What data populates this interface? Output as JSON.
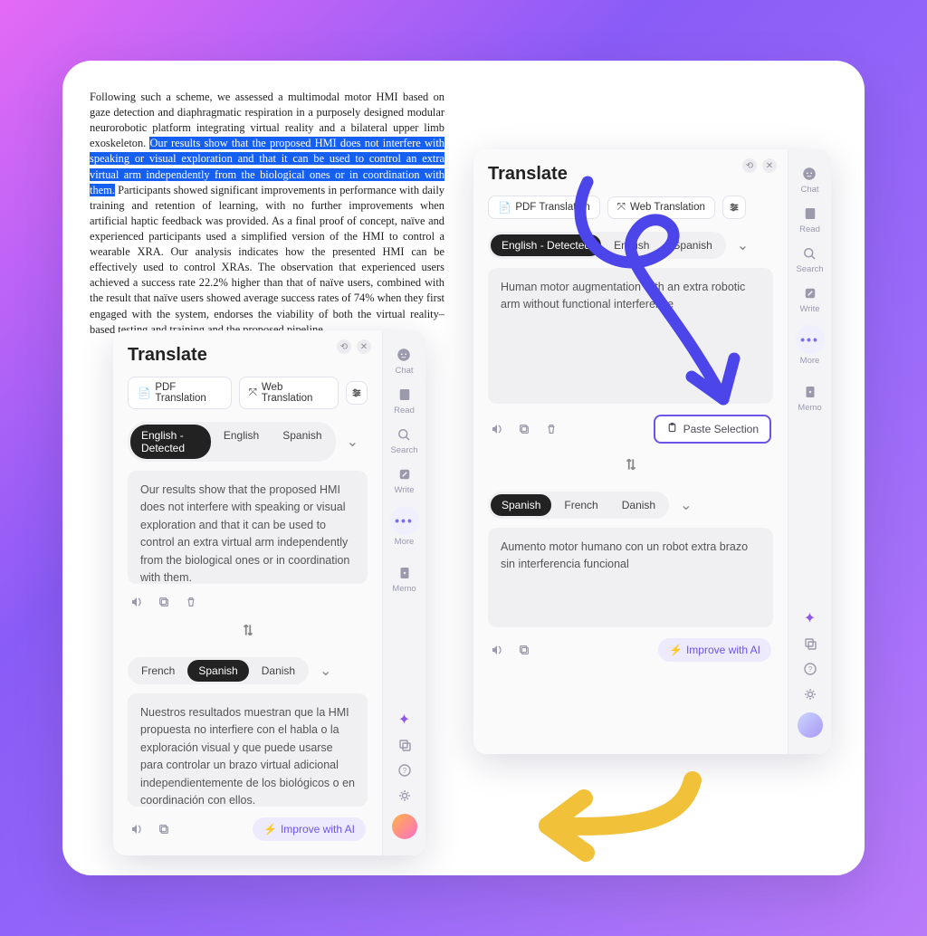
{
  "paragraph": {
    "pre": "Following such a scheme, we assessed a multimodal motor HMI based on gaze detection and diaphragmatic respiration in a purposely designed modular neurorobotic platform integrating virtual reality and a bilateral upper limb exoskeleton. ",
    "highlight": "Our results show that the proposed HMI does not interfere with speaking or visual exploration and that it can be used to control an extra virtual arm independently from the biological ones or in coordination with them.",
    "post": " Participants showed significant improvements in performance with daily training and retention of learning, with no further improvements when artificial haptic feedback was provided. As a final proof of concept, naïve and experienced participants used a simplified version of the HMI to control a wearable XRA. Our analysis indicates how the presented HMI can be effectively used to control XRAs. The observation that experienced users achieved a success rate 22.2% higher than that of naïve users, combined with the result that naïve users showed average success rates of 74% when they first engaged with the system, endorses the viability of both the virtual reality–based testing and training and the proposed pipeline."
  },
  "panelL": {
    "title": "Translate",
    "pdf": "PDF Translation",
    "web": "Web Translation",
    "src_langs": [
      "English - Detected",
      "English",
      "Spanish"
    ],
    "src_active": 0,
    "src_text": "Our results show that the proposed HMI does not interfere with speaking or visual exploration and that it can be used to control an extra virtual arm independently from the biological ones or in coordination with them.",
    "tgt_langs": [
      "French",
      "Spanish",
      "Danish"
    ],
    "tgt_active": 1,
    "tgt_text": "Nuestros resultados muestran que la HMI propuesta no interfiere con el habla o la exploración visual y que puede usarse para controlar un brazo virtual adicional independientemente de los biológicos o en coordinación con ellos.",
    "improve": "Improve with AI",
    "side": {
      "chat": "Chat",
      "read": "Read",
      "search": "Search",
      "write": "Write",
      "more": "More",
      "memo": "Memo"
    }
  },
  "panelR": {
    "title": "Translate",
    "pdf": "PDF Translation",
    "web": "Web Translation",
    "src_langs": [
      "English - Detected",
      "English",
      "Spanish"
    ],
    "src_active": 0,
    "src_text": "Human motor augmentation with an extra robotic arm without functional interference",
    "paste": "Paste Selection",
    "tgt_langs": [
      "Spanish",
      "French",
      "Danish"
    ],
    "tgt_active": 0,
    "tgt_text": "Aumento motor humano con un robot extra brazo sin interferencia funcional",
    "improve": "Improve with AI",
    "side": {
      "chat": "Chat",
      "read": "Read",
      "search": "Search",
      "write": "Write",
      "more": "More",
      "memo": "Memo"
    }
  }
}
